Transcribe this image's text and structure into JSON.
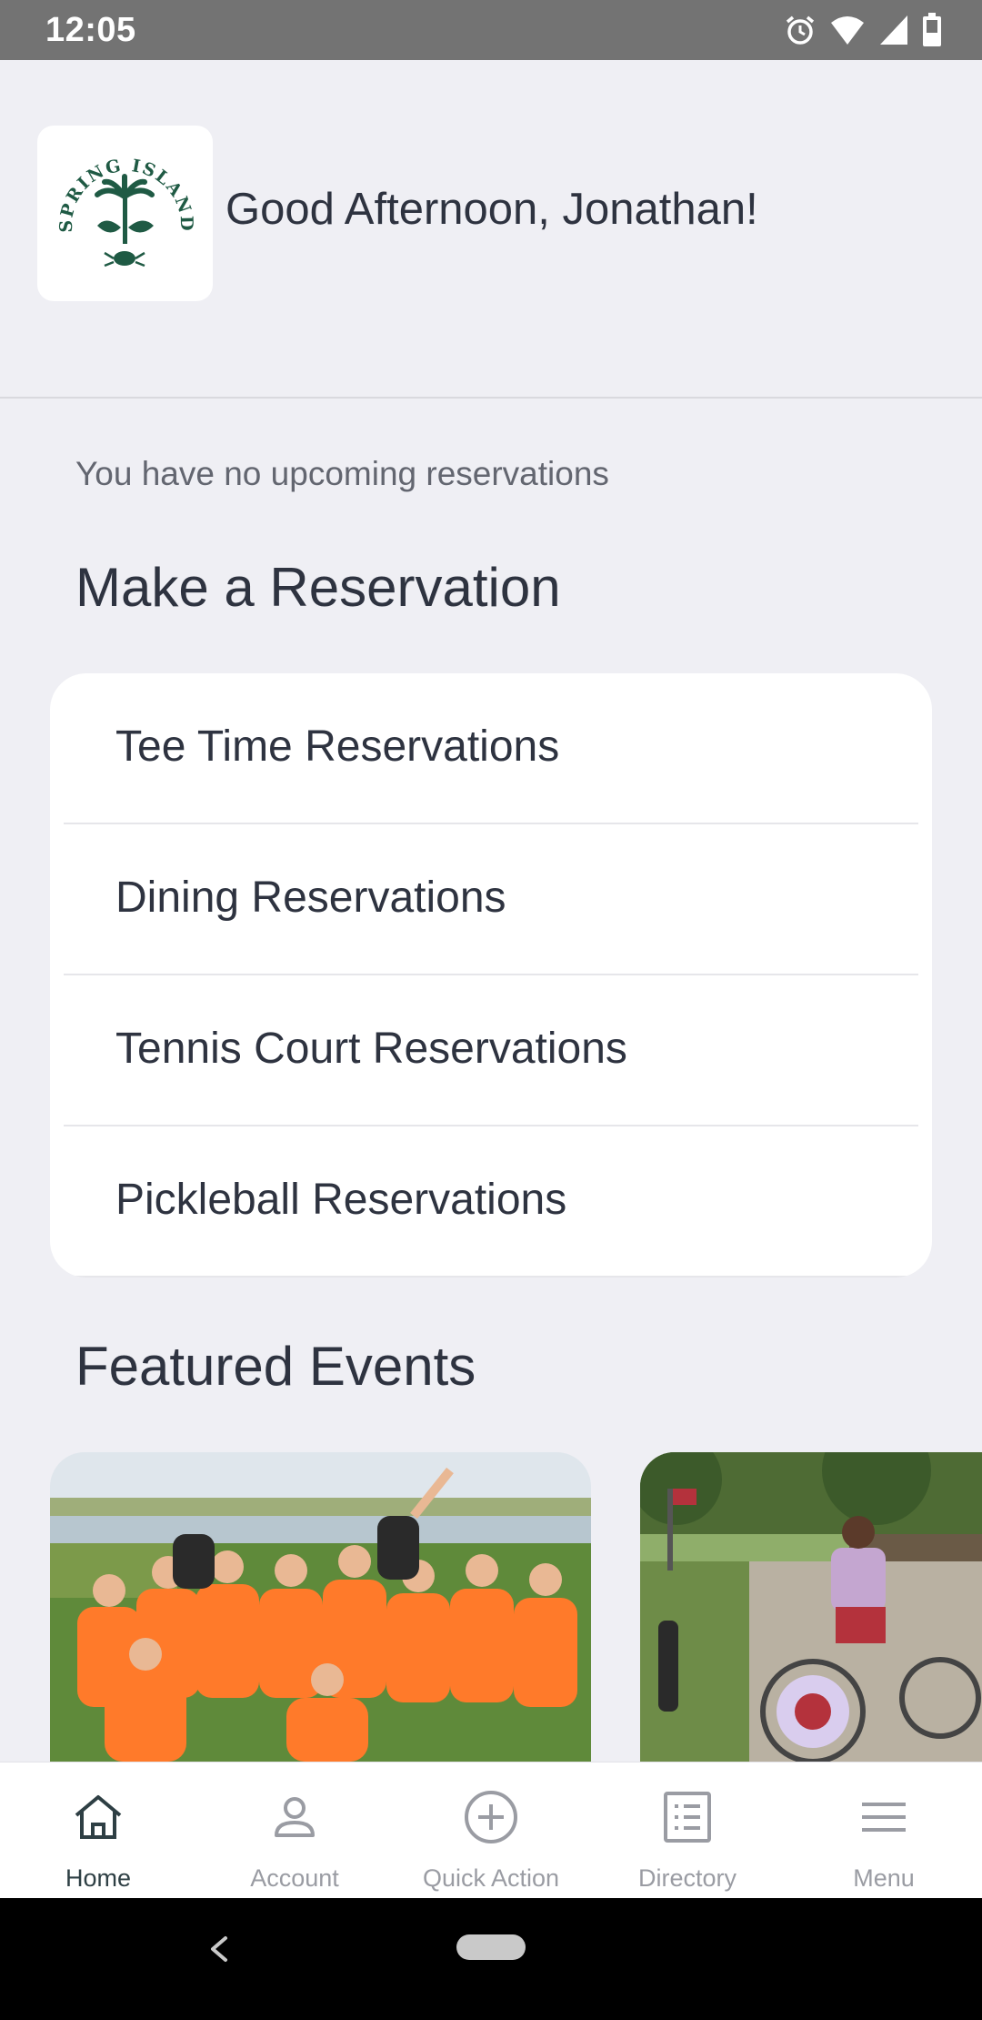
{
  "status_bar": {
    "time": "12:05",
    "icons": [
      "alarm-icon",
      "wifi-icon",
      "signal-icon",
      "battery-icon"
    ]
  },
  "header": {
    "logo_text": "SPRING ISLAND",
    "greeting": "Good Afternoon, Jonathan!"
  },
  "reservations": {
    "empty_message": "You have no upcoming reservations",
    "title": "Make a Reservation",
    "items": [
      {
        "label": "Tee Time Reservations"
      },
      {
        "label": "Dining Reservations"
      },
      {
        "label": "Tennis Court Reservations"
      },
      {
        "label": "Pickleball Reservations"
      }
    ]
  },
  "events": {
    "title": "Featured Events",
    "cards": [
      "event-photo-kids-group",
      "event-photo-bike-parade"
    ]
  },
  "bottom_nav": {
    "items": [
      {
        "label": "Home",
        "icon": "home-icon",
        "active": true
      },
      {
        "label": "Account",
        "icon": "account-icon",
        "active": false
      },
      {
        "label": "Quick Action",
        "icon": "plus-circle-icon",
        "active": false
      },
      {
        "label": "Directory",
        "icon": "directory-icon",
        "active": false
      },
      {
        "label": "Menu",
        "icon": "menu-icon",
        "active": false
      }
    ]
  },
  "colors": {
    "background": "#efeff4",
    "brand_green": "#1f5a44",
    "text_dark": "#2e3340",
    "nav_inactive": "#9a9ca3"
  }
}
